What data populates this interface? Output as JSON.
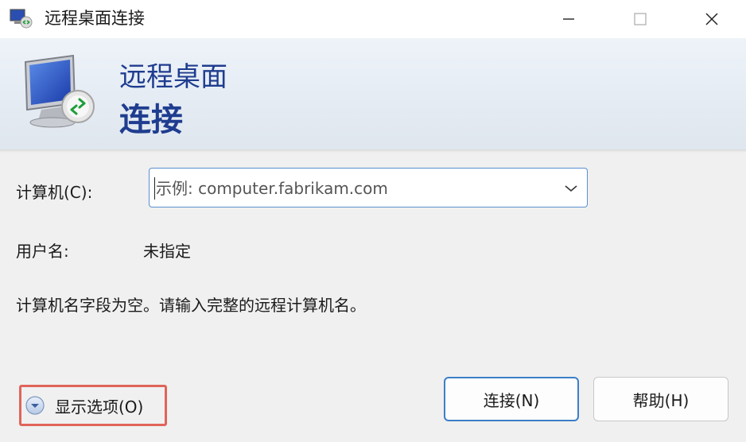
{
  "window": {
    "title": "远程桌面连接",
    "minimize_icon": "minimize-icon",
    "maximize_icon": "maximize-icon",
    "close_icon": "close-icon"
  },
  "banner": {
    "line1": "远程桌面",
    "line2": "连接",
    "icon": "remote-desktop-monitor-icon"
  },
  "form": {
    "computer_label": "计算机(C):",
    "computer_value": "",
    "computer_placeholder": "示例: computer.fabrikam.com",
    "username_label": "用户名:",
    "username_value": "未指定",
    "message": "计算机名字段为空。请输入完整的远程计算机名。"
  },
  "footer": {
    "show_options_label": "显示选项(O)",
    "connect_label": "连接(N)",
    "help_label": "帮助(H)"
  },
  "colors": {
    "banner_text": "#1f3d8f",
    "focus_border": "#3c7fc8",
    "highlight_box": "#e0645a"
  }
}
